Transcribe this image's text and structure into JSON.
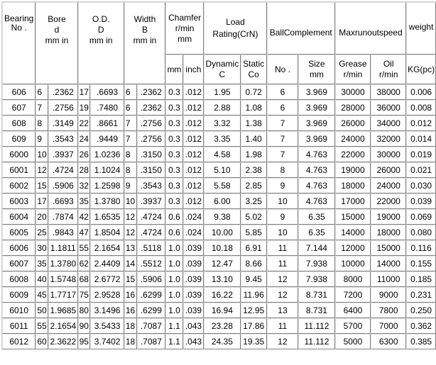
{
  "header": {
    "bearing_no": [
      "Bearing",
      "No ."
    ],
    "bore": [
      "Bore",
      "d",
      "mm in"
    ],
    "od": [
      "O.D.",
      "D",
      "mm in"
    ],
    "width": [
      "Width",
      "B",
      "mm in"
    ],
    "chamfer": [
      "Chamfer",
      "r/min",
      "mm"
    ],
    "chamfer_mm": "mm",
    "chamfer_inch": "inch",
    "load_rating": [
      "Load",
      "Rating(CrN)"
    ],
    "dynamic": [
      "Dynamic",
      "C"
    ],
    "static": [
      "Static",
      "Co"
    ],
    "ball_complement": "BallComplement",
    "ball_no": "No .",
    "size": [
      "Size",
      "mm"
    ],
    "max_runout_speed": "Maxrunoutspeed",
    "grease": [
      "Grease",
      "r/min"
    ],
    "oil": [
      "Oil",
      "r/min"
    ],
    "weight": "weight",
    "kg": "KG(pc)"
  },
  "rows": [
    [
      "606",
      "6",
      ".2362",
      "17",
      ".6693",
      "6",
      ".2362",
      "0.3",
      ".012",
      "1.95",
      "0.72",
      "6",
      "3.969",
      "30000",
      "38000",
      "0.006"
    ],
    [
      "607",
      "7",
      ".2756",
      "19",
      ".7480",
      "6",
      ".2362",
      "0.3",
      ".012",
      "2.88",
      "1.08",
      "6",
      "3.969",
      "28000",
      "36000",
      "0.008"
    ],
    [
      "608",
      "8",
      ".3149",
      "22",
      ".8661",
      "7",
      ".2756",
      "0.3",
      ".012",
      "3.32",
      "1.38",
      "7",
      "3.969",
      "26000",
      "34000",
      "0.012"
    ],
    [
      "609",
      "9",
      ".3543",
      "24",
      ".9449",
      "7",
      ".2756",
      "0.3",
      ".012",
      "3.35",
      "1.40",
      "7",
      "3.969",
      "24000",
      "32000",
      "0.014"
    ],
    [
      "6000",
      "10",
      ".3937",
      "26",
      "1.0236",
      "8",
      ".3150",
      "0.3",
      ".012",
      "4.58",
      "1.98",
      "7",
      "4.763",
      "22000",
      "30000",
      "0.019"
    ],
    [
      "6001",
      "12",
      ".4724",
      "28",
      "1.1024",
      "8",
      ".3150",
      "0.3",
      ".012",
      "5.10",
      "2.38",
      "8",
      "4.763",
      "19000",
      "26000",
      "0.021"
    ],
    [
      "6002",
      "15",
      ".5906",
      "32",
      "1.2598",
      "9",
      ".3543",
      "0.3",
      ".012",
      "5.58",
      "2.85",
      "9",
      "4.763",
      "18000",
      "24000",
      "0.030"
    ],
    [
      "6003",
      "17",
      ".6693",
      "35",
      "1.3780",
      "10",
      ".3937",
      "0.3",
      ".012",
      "6.00",
      "3.25",
      "10",
      "4.763",
      "17000",
      "22000",
      "0.039"
    ],
    [
      "6004",
      "20",
      ".7874",
      "42",
      "1.6535",
      "12",
      ".4724",
      "0.6",
      ".024",
      "9.38",
      "5.02",
      "9",
      "6.35",
      "15000",
      "19000",
      "0.069"
    ],
    [
      "6005",
      "25",
      ".9843",
      "47",
      "1.8504",
      "12",
      ".4724",
      "0.6",
      ".024",
      "10.00",
      "5.85",
      "10",
      "6.35",
      "14000",
      "18000",
      "0.080"
    ],
    [
      "6006",
      "30",
      "1.1811",
      "55",
      "2.1654",
      "13",
      ".5118",
      "1.0",
      ".039",
      "10.18",
      "6.91",
      "11",
      "7.144",
      "12000",
      "15000",
      "0.116"
    ],
    [
      "6007",
      "35",
      "1.3780",
      "62",
      "2.4409",
      "14",
      ".5512",
      "1.0",
      ".039",
      "12.47",
      "8.66",
      "11",
      "7.938",
      "10000",
      "14000",
      "0.155"
    ],
    [
      "6008",
      "40",
      "1.5748",
      "68",
      "2.6772",
      "15",
      ".5906",
      "1.0",
      ".039",
      "13.10",
      "9.45",
      "12",
      "7.938",
      "8000",
      "11000",
      "0.185"
    ],
    [
      "6009",
      "45",
      "1.7717",
      "75",
      "2.9528",
      "16",
      ".6299",
      "1.0",
      ".039",
      "16.22",
      "11.96",
      "12",
      "8.731",
      "7200",
      "9000",
      "0.231"
    ],
    [
      "6010",
      "50",
      "1.9685",
      "80",
      "3.1496",
      "16",
      ".6299",
      "1.0",
      ".039",
      "16.94",
      "12.95",
      "13",
      "8.731",
      "6400",
      "7800",
      "0.250"
    ],
    [
      "6011",
      "55",
      "2.1654",
      "90",
      "3.5433",
      "18",
      ".7087",
      "1.1",
      ".043",
      "23.28",
      "17.86",
      "11",
      "11.112",
      "5700",
      "7000",
      "0.362"
    ],
    [
      "6012",
      "60",
      "2.3622",
      "95",
      "3.7402",
      "18",
      ".7087",
      "1.1",
      ".043",
      "24.35",
      "19.35",
      "12",
      "11.112",
      "5000",
      "6300",
      "0.385"
    ]
  ]
}
